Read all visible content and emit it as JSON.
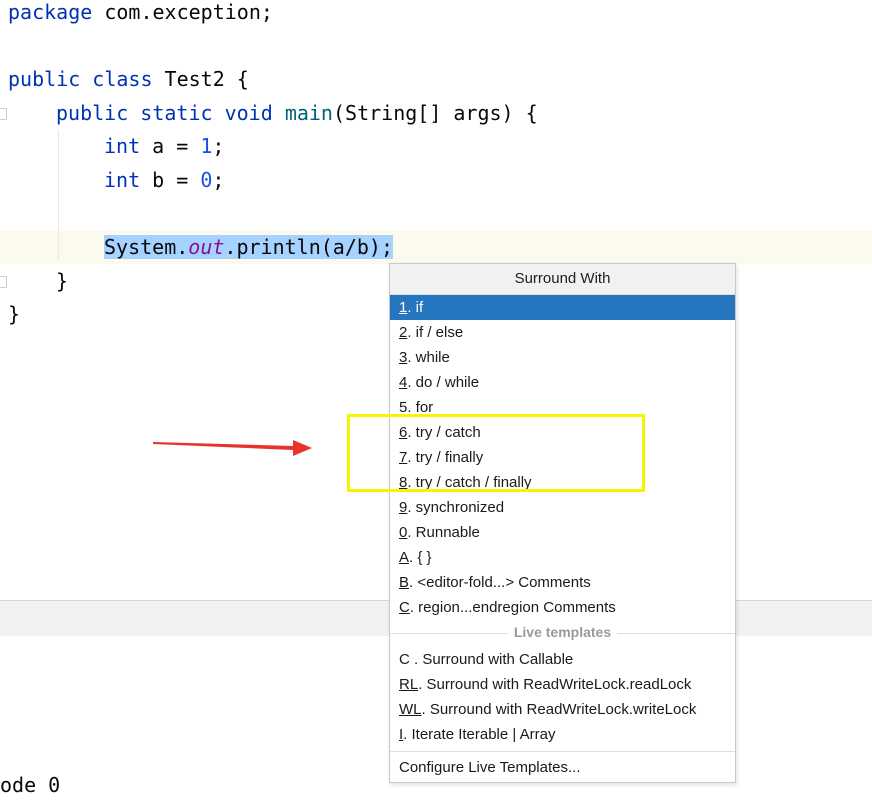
{
  "editor": {
    "lines": {
      "l1": {
        "kw1": "package",
        "rest": " com.exception;"
      },
      "l3": {
        "kw1": "public",
        "kw2": "class",
        "rest": " Test2 {"
      },
      "l4": {
        "kw1": "public",
        "kw2": "static",
        "kw3": "void",
        "fn": "main",
        "rest": "(String[] args) {"
      },
      "l5": {
        "kw": "int",
        "mid": " a = ",
        "num": "1",
        "end": ";"
      },
      "l6": {
        "kw": "int",
        "mid": " b = ",
        "num": "0",
        "end": ";"
      },
      "l8": {
        "sys": "System.",
        "field": "out",
        "call": ".println(a/b);"
      },
      "l9": {
        "brace": "}"
      },
      "l10": {
        "brace": "}"
      }
    }
  },
  "console": {
    "text": "ode 0"
  },
  "popup": {
    "title": "Surround With",
    "items": [
      {
        "key": "1",
        "label": ". if"
      },
      {
        "key": "2",
        "label": ". if / else"
      },
      {
        "key": "3",
        "label": ". while"
      },
      {
        "key": "4",
        "label": ". do / while"
      },
      {
        "key": "",
        "label": "5. for"
      },
      {
        "key": "6",
        "label": ". try / catch"
      },
      {
        "key": "7",
        "label": ". try / finally"
      },
      {
        "key": "8",
        "label": ". try / catch / finally"
      },
      {
        "key": "9",
        "label": ". synchronized"
      },
      {
        "key": "0",
        "label": ". Runnable"
      },
      {
        "key": "A",
        "label": ". { }"
      },
      {
        "key": "B",
        "label": ". <editor-fold...> Comments"
      },
      {
        "key": "C",
        "label": ". region...endregion Comments"
      }
    ],
    "live_templates_label": "Live templates",
    "live_items": [
      {
        "key": "",
        "label": "C . Surround with Callable"
      },
      {
        "key": "RL",
        "label": ". Surround with ReadWriteLock.readLock"
      },
      {
        "key": "WL",
        "label": ". Surround with ReadWriteLock.writeLock"
      },
      {
        "key": "I",
        "label": ". Iterate Iterable | Array"
      }
    ],
    "footer": "Configure Live Templates..."
  },
  "colors": {
    "selection": "#a6d2ff",
    "menu_selected": "#2675bf",
    "highlight_box": "#f5f500",
    "arrow": "#e8322c"
  }
}
